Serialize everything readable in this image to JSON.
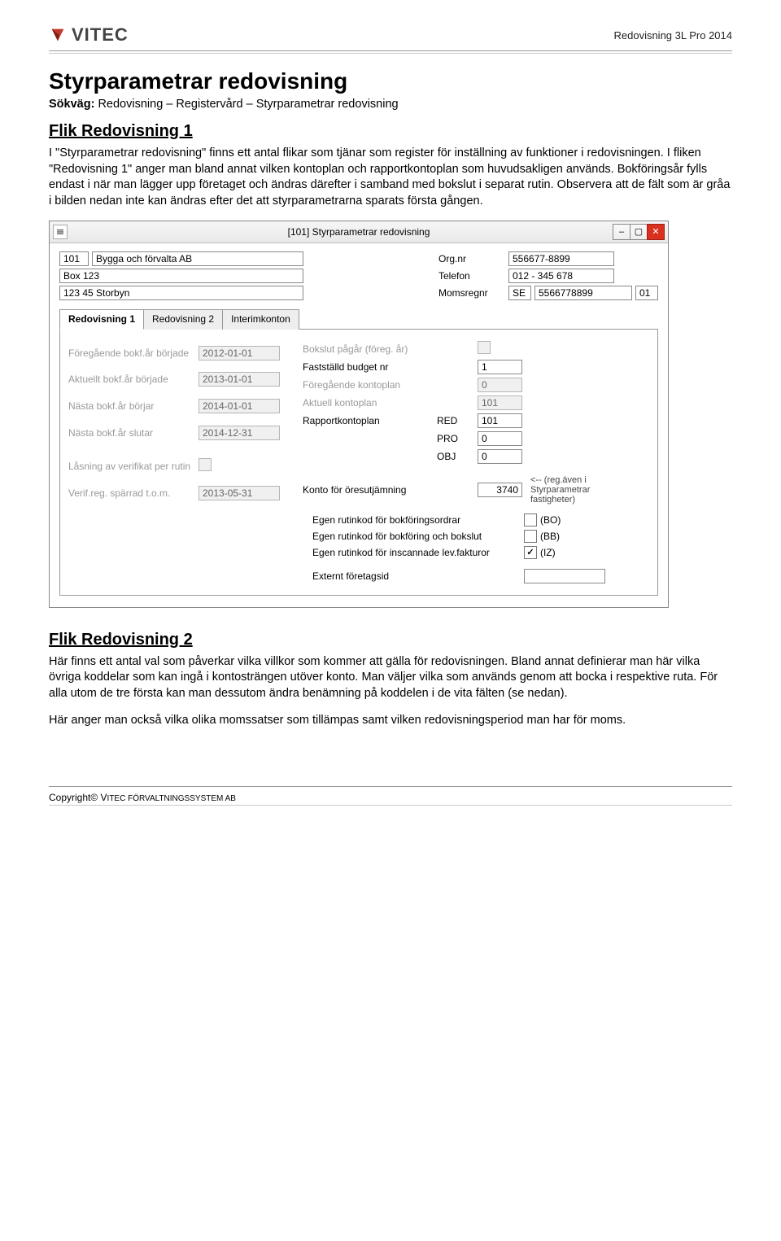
{
  "header": {
    "brand": "VITEC",
    "product": "Redovisning 3L Pro 2014"
  },
  "doc": {
    "title": "Styrparametrar redovisning",
    "sokvag_label": "Sökväg:",
    "sokvag_value": "Redovisning – Registervård – Styrparametrar redovisning",
    "section1": "Flik Redovisning 1",
    "para1": "I \"Styrparametrar redovisning\" finns ett antal flikar som tjänar som register för inställning av funktioner i redovisningen. I fliken \"Redovisning 1\" anger man bland annat vilken kontoplan och rapportkontoplan som huvudsakligen används. Bokföringsår fylls endast i när man lägger upp företaget och ändras därefter i samband med bokslut i separat rutin. Observera att de fält som är gråa i bilden nedan inte kan ändras efter det att styrparametrarna sparats första gången.",
    "section2": "Flik Redovisning 2",
    "para2": "Här finns ett antal val som påverkar vilka villkor som kommer att gälla för redovisningen. Bland annat definierar man här vilka övriga koddelar som kan ingå i kontosträngen utöver konto. Man väljer vilka som används genom att bocka i respektive ruta. För alla utom de tre första kan man dessutom ändra benämning på koddelen i de vita fälten (se nedan).",
    "para3": "Här anger man också vilka olika momssatser som tillämpas samt vilken redovisningsperiod man har för moms."
  },
  "win": {
    "title": "[101]  Styrparametrar redovisning",
    "company": {
      "id": "101",
      "name": "Bygga och förvalta AB",
      "box": "Box 123",
      "zipcity": "123 45  Storbyn"
    },
    "info": {
      "orgnr_label": "Org.nr",
      "orgnr": "556677-8899",
      "tel_label": "Telefon",
      "tel": "012 - 345 678",
      "moms_label": "Momsregnr",
      "moms_cc": "SE",
      "moms_nr": "5566778899",
      "moms_sfx": "01"
    },
    "tabs": {
      "t1": "Redovisning 1",
      "t2": "Redovisning 2",
      "t3": "Interimkonton"
    },
    "left": {
      "l1": "Föregående bokf.år började",
      "v1": "2012-01-01",
      "l2": "Aktuellt bokf.år började",
      "v2": "2013-01-01",
      "l3": "Nästa bokf.år börjar",
      "v3": "2014-01-01",
      "l4": "Nästa bokf.år slutar",
      "v4": "2014-12-31",
      "l5": "Låsning av verifikat per rutin",
      "l6": "Verif.reg. spärrad t.o.m.",
      "v6": "2013-05-31"
    },
    "right": {
      "r1": "Bokslut pågår (föreg. år)",
      "r2": "Fastställd budget nr",
      "r2v": "1",
      "r3": "Föregående kontoplan",
      "r3v": "0",
      "r4": "Aktuell kontoplan",
      "r4v": "101",
      "r5": "Rapportkontoplan",
      "r5_red": "RED",
      "r5_red_v": "101",
      "r5_pro": "PRO",
      "r5_pro_v": "0",
      "r5_obj": "OBJ",
      "r5_obj_v": "0",
      "r6": "Konto för öresutjämning",
      "r6v": "3740",
      "r6note": "<-- (reg.även i Styrparametrar fastigheter)",
      "r7": "Egen rutinkod för bokföringsordrar",
      "r7code": "(BO)",
      "r8": "Egen rutinkod för bokföring och bokslut",
      "r8code": "(BB)",
      "r9": "Egen rutinkod för inscannade lev.fakturor",
      "r9code": "(IZ)",
      "r10": "Externt företagsid"
    }
  },
  "footer": {
    "copyright_pre": "Copyright© V",
    "copyright_sc": "itec förvaltningssystem ab"
  }
}
